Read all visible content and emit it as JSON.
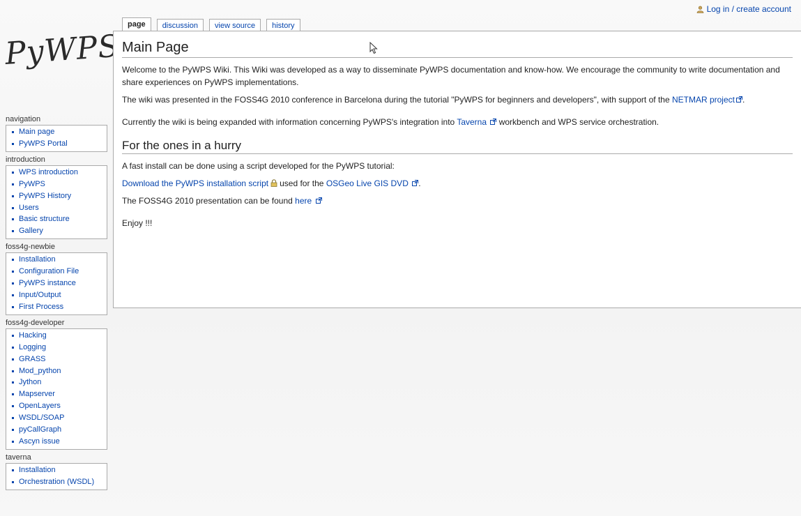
{
  "logo_text": "PyWPS",
  "personal": {
    "login_label": "Log in / create account"
  },
  "tabs": [
    {
      "label": "page",
      "selected": true
    },
    {
      "label": "discussion"
    },
    {
      "label": "view source"
    },
    {
      "label": "history"
    }
  ],
  "content": {
    "title": "Main Page",
    "intro_p1": "Welcome to the PyWPS Wiki. This Wiki was developed as a way to disseminate PyWPS documentation and know-how. We encourage the community to write documentation and share experiences on PyWPS implementations.",
    "intro_p2_text": "The wiki was presented in the FOSS4G 2010 conference in Barcelona during the tutorial \"PyWPS for beginners and developers\", with support of the ",
    "intro_p2_link": "NETMAR project",
    "intro_p3_before": "Currently the wiki is being expanded with information concerning PyWPS's integration into ",
    "intro_p3_link": "Taverna",
    "intro_p3_after": " workbench and WPS service orchestration.",
    "section_title": "For the ones in a hurry",
    "hurry_p1": "A fast install can be done using a script developed for the PyWPS tutorial:",
    "hurry_p2_link": "Download the PyWPS installation script",
    "hurry_p2_middle": "used for the ",
    "hurry_p2_link2": "OSGeo Live GIS DVD",
    "hurry_p3_text": "The FOSS4G 2010 presentation can be found ",
    "hurry_p3_link": "here",
    "enjoy": "Enjoy !!!"
  },
  "sidebar": [
    {
      "title": "navigation",
      "items": [
        "Main page",
        "PyWPS Portal"
      ]
    },
    {
      "title": "introduction",
      "items": [
        "WPS introduction",
        "PyWPS",
        "PyWPS History",
        "Users",
        "Basic structure",
        "Gallery"
      ]
    },
    {
      "title": "foss4g-newbie",
      "items": [
        "Installation",
        "Configuration File",
        "PyWPS instance",
        "Input/Output",
        "First Process"
      ]
    },
    {
      "title": "foss4g-developer",
      "items": [
        "Hacking",
        "Logging",
        "GRASS",
        "Mod_python",
        "Jython",
        "Mapserver",
        "OpenLayers",
        "WSDL/SOAP",
        "pyCallGraph",
        "Ascyn issue"
      ]
    },
    {
      "title": "taverna",
      "items": [
        "Installation",
        "Orchestration (WSDL)"
      ]
    }
  ],
  "colors": {
    "link": "#0645ad",
    "border": "#aaaaaa",
    "background": "#f7f7f7"
  }
}
